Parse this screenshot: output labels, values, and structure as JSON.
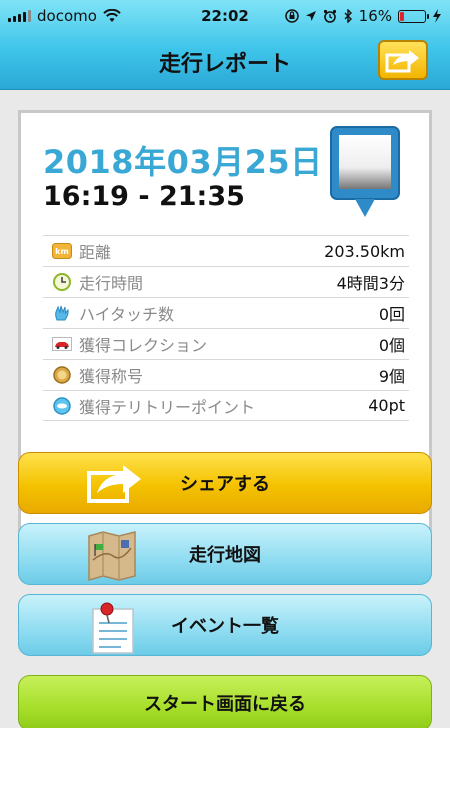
{
  "status_bar": {
    "carrier": "docomo",
    "time": "22:02",
    "battery_percent": "16%"
  },
  "header": {
    "title": "走行レポート",
    "share_icon": "share-arrow-icon"
  },
  "report": {
    "date": "2018年03月25日",
    "time_range": "16:19 - 21:35",
    "stats": [
      {
        "icon": "km-icon",
        "label": "距離",
        "value": "203.50km"
      },
      {
        "icon": "clock-icon",
        "label": "走行時間",
        "value": "4時間3分"
      },
      {
        "icon": "hand-icon",
        "label": "ハイタッチ数",
        "value": "0回"
      },
      {
        "icon": "car-icon",
        "label": "獲得コレクション",
        "value": "0個"
      },
      {
        "icon": "medal-icon",
        "label": "獲得称号",
        "value": "9個"
      },
      {
        "icon": "spot-icon",
        "label": "獲得テリトリーポイント",
        "value": "40pt"
      }
    ]
  },
  "buttons": {
    "share": "シェアする",
    "map": "走行地図",
    "events": "イベント一覧",
    "back_to_start": "スタート画面に戻る"
  },
  "colors": {
    "accent": "#3aa8d4",
    "share_yellow": "#f4c200",
    "map_blue": "#8fdcf1",
    "start_green": "#a6de2a"
  }
}
